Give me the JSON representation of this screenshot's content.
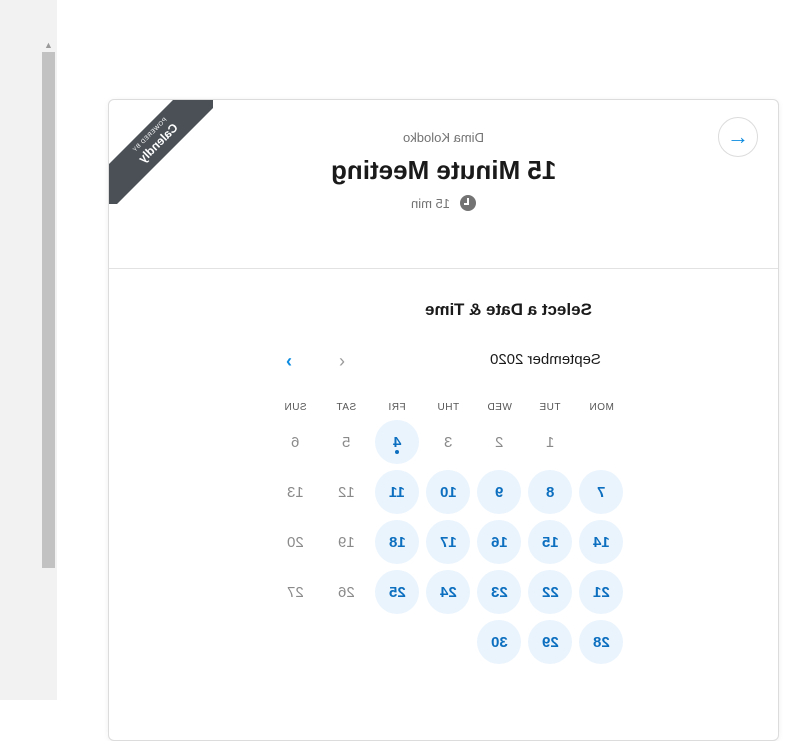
{
  "scrollbar": {
    "arrow_up": "▲"
  },
  "booking": {
    "ribbon": {
      "powered_by": "POWERED BY",
      "brand": "Calendly"
    },
    "back_icon": "arrow-right-icon",
    "back_glyph": "→",
    "host": "Dima Kolodko",
    "title": "15 Minute Meeting",
    "duration": "15 min",
    "select_title": "Select a Date & Time",
    "calendar": {
      "month": "September 2020",
      "prev_glyph": "‹",
      "next_glyph": "›",
      "weekdays": [
        "MON",
        "TUE",
        "WED",
        "THU",
        "FRI",
        "SAT",
        "SUN"
      ],
      "weeks": [
        [
          null,
          {
            "d": "1",
            "s": "off"
          },
          {
            "d": "2",
            "s": "off"
          },
          {
            "d": "3",
            "s": "off"
          },
          {
            "d": "4",
            "s": "today"
          },
          {
            "d": "5",
            "s": "off"
          },
          {
            "d": "6",
            "s": "off"
          }
        ],
        [
          {
            "d": "7",
            "s": "avail"
          },
          {
            "d": "8",
            "s": "avail"
          },
          {
            "d": "9",
            "s": "avail"
          },
          {
            "d": "10",
            "s": "avail"
          },
          {
            "d": "11",
            "s": "avail"
          },
          {
            "d": "12",
            "s": "off"
          },
          {
            "d": "13",
            "s": "off"
          }
        ],
        [
          {
            "d": "14",
            "s": "avail"
          },
          {
            "d": "15",
            "s": "avail"
          },
          {
            "d": "16",
            "s": "avail"
          },
          {
            "d": "17",
            "s": "avail"
          },
          {
            "d": "18",
            "s": "avail"
          },
          {
            "d": "19",
            "s": "off"
          },
          {
            "d": "20",
            "s": "off"
          }
        ],
        [
          {
            "d": "21",
            "s": "avail"
          },
          {
            "d": "22",
            "s": "avail"
          },
          {
            "d": "23",
            "s": "avail"
          },
          {
            "d": "24",
            "s": "avail"
          },
          {
            "d": "25",
            "s": "avail"
          },
          {
            "d": "26",
            "s": "off"
          },
          {
            "d": "27",
            "s": "off"
          }
        ],
        [
          {
            "d": "28",
            "s": "avail"
          },
          {
            "d": "29",
            "s": "avail"
          },
          {
            "d": "30",
            "s": "avail"
          },
          null,
          null,
          null,
          null
        ]
      ]
    }
  },
  "colors": {
    "accent": "#0d8ce0",
    "available_bg": "#eaf4fd",
    "available_text": "#0d6fbf",
    "ribbon": "#4a5056"
  }
}
